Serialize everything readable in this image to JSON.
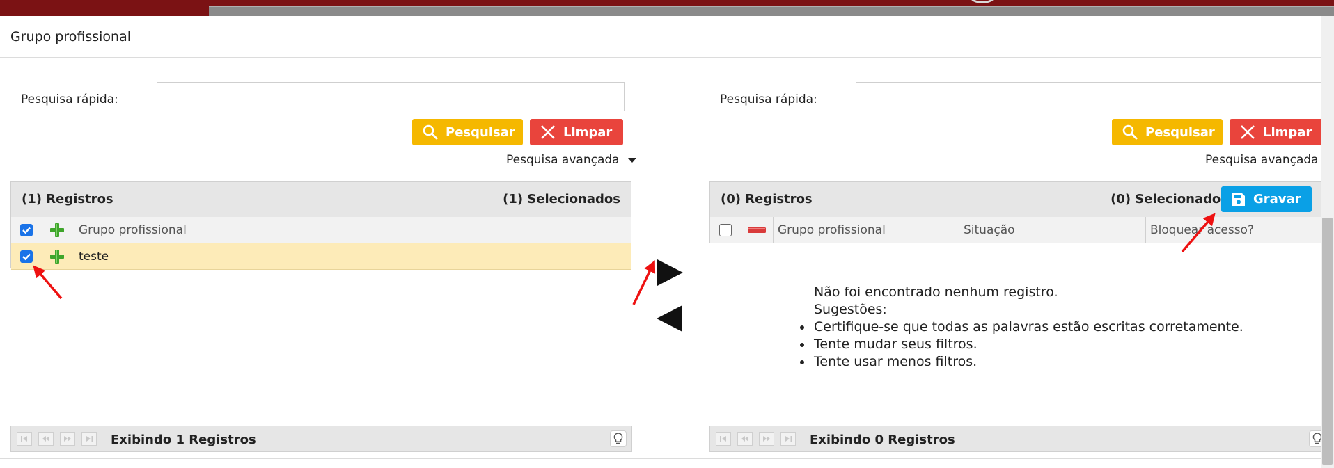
{
  "modal": {
    "title": "Grupo profissional"
  },
  "left": {
    "search_label": "Pesquisa rápida:",
    "search_value": "",
    "search_button": "Pesquisar",
    "clear_button": "Limpar",
    "advanced_search": "Pesquisa avançada",
    "records": "(1) Registros",
    "selected": "(1) Selecionados",
    "columns": [
      "Grupo profissional"
    ],
    "rows": [
      {
        "grupo": "teste",
        "checked": true
      }
    ],
    "footer_info": "Exibindo 1 Registros"
  },
  "right": {
    "search_label": "Pesquisa rápida:",
    "search_value": "",
    "search_button": "Pesquisar",
    "clear_button": "Limpar",
    "advanced_search": "Pesquisa avançada",
    "records": "(0) Registros",
    "selected": "(0) Selecionados",
    "save_button": "Gravar",
    "columns": [
      "Grupo profissional",
      "Situação",
      "Bloquear acesso?"
    ],
    "empty": {
      "message": "Não foi encontrado nenhum registro.",
      "suggestions_label": "Sugestões:",
      "suggestions": [
        "Certifique-se que todas as palavras estão escritas corretamente.",
        "Tente mudar seus filtros.",
        "Tente usar menos filtros."
      ]
    },
    "footer_info": "Exibindo 0 Registros"
  },
  "colors": {
    "search_button": "#f5b800",
    "clear_button": "#e9443c",
    "save_button": "#0aa0e6",
    "selected_row": "#fdebb8",
    "top_bar": "#7b1214",
    "annotation_arrow": "#ee1111"
  },
  "icons": {
    "search": "search-icon",
    "clear": "close-icon",
    "save": "floppy-disk-icon",
    "add": "plus-icon",
    "remove": "minus-icon",
    "move_right": "triangle-right-icon",
    "move_left": "triangle-left-icon",
    "tip": "lightbulb-icon"
  }
}
